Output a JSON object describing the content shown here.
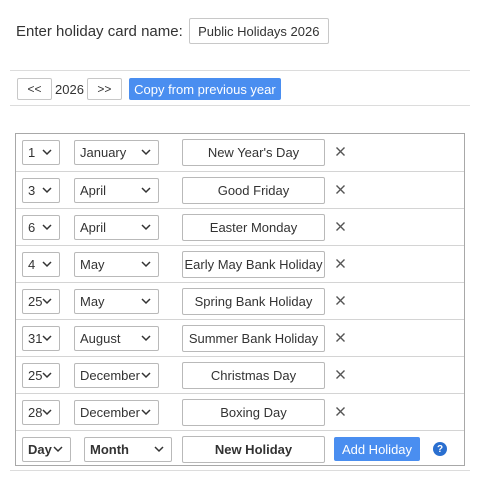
{
  "card_name": {
    "label": "Enter holiday card name:",
    "value": "Public Holidays 2026"
  },
  "year_nav": {
    "prev_label": "<<",
    "year": "2026",
    "next_label": ">>",
    "copy_label": "Copy from previous year"
  },
  "holidays": [
    {
      "day": "1",
      "month": "January",
      "name": "New Year's Day"
    },
    {
      "day": "3",
      "month": "April",
      "name": "Good Friday"
    },
    {
      "day": "6",
      "month": "April",
      "name": "Easter Monday"
    },
    {
      "day": "4",
      "month": "May",
      "name": "Early May Bank Holiday"
    },
    {
      "day": "25",
      "month": "May",
      "name": "Spring Bank Holiday"
    },
    {
      "day": "31",
      "month": "August",
      "name": "Summer Bank Holiday"
    },
    {
      "day": "25",
      "month": "December",
      "name": "Christmas Day"
    },
    {
      "day": "28",
      "month": "December",
      "name": "Boxing Day"
    }
  ],
  "new_holiday": {
    "day_placeholder": "Day",
    "month_placeholder": "Month",
    "name_placeholder": "New Holiday",
    "add_label": "Add Holiday",
    "help_label": "?"
  },
  "colors": {
    "accent": "#4a8ef0",
    "help": "#2a6fd0"
  },
  "icons": {
    "delete": "close-icon",
    "dropdown": "chevron-down-icon",
    "help": "help-icon"
  }
}
